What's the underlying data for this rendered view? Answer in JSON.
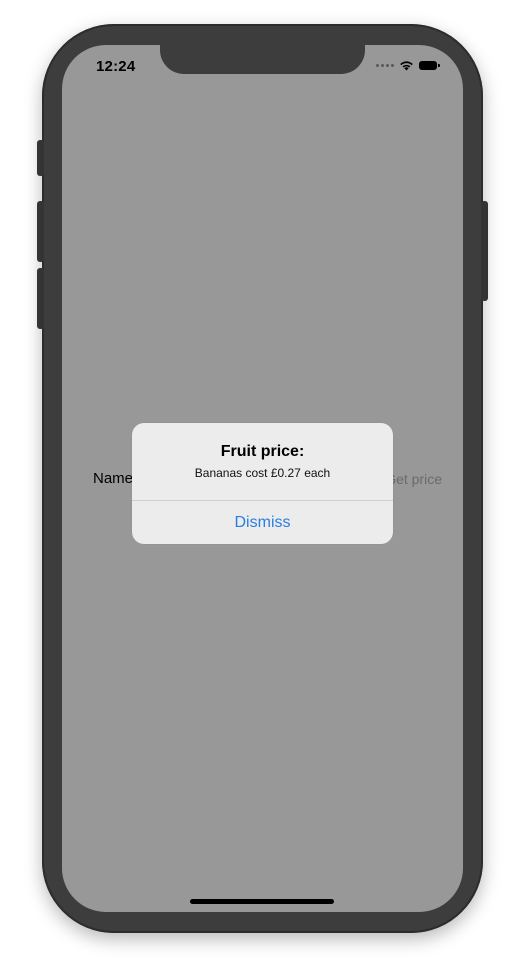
{
  "status_bar": {
    "time": "12:24"
  },
  "background": {
    "label_text": "Name",
    "input_placeholder": "Get price"
  },
  "alert": {
    "title": "Fruit price:",
    "message": "Bananas cost £0.27 each",
    "dismiss_label": "Dismiss"
  },
  "colors": {
    "screen_dim": "#989898",
    "alert_background": "#ececec",
    "action_blue": "#2a7ee0",
    "device_frame": "#3d3d3d"
  },
  "icons": {
    "signal": "cellular-signal-icon",
    "wifi": "wifi-icon",
    "battery": "battery-icon"
  }
}
